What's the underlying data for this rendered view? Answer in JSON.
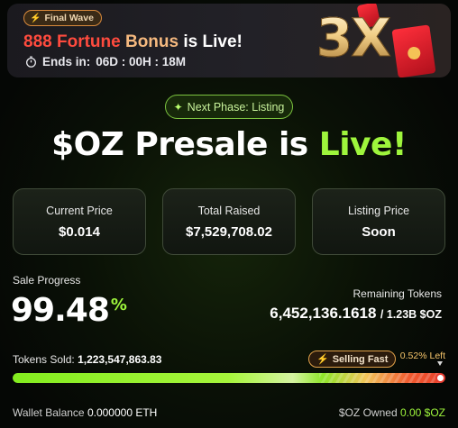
{
  "banner": {
    "badge_icon": "lightning-icon",
    "badge_label": "Final Wave",
    "title_part1": "888 Fortune",
    "title_part2": "Bonus",
    "title_part3": "is Live!",
    "countdown_icon": "stopwatch-icon",
    "countdown_label": "Ends in:",
    "countdown_value": "06D : 00H : 18M",
    "multiplier": "3X",
    "colors": {
      "red": "#ff4b3e",
      "gold": "#f5b97f"
    }
  },
  "phase_pill": {
    "icon": "sparkle-icon",
    "label": "Next Phase: Listing"
  },
  "headline": {
    "part1": "$OZ Presale is",
    "part2": "Live!"
  },
  "stats": [
    {
      "label": "Current Price",
      "value": "$0.014"
    },
    {
      "label": "Total Raised",
      "value": "$7,529,708.02"
    },
    {
      "label": "Listing Price",
      "value": "Soon"
    }
  ],
  "progress": {
    "sale_label": "Sale Progress",
    "percent": "99.48",
    "percent_sign": "%",
    "remaining_label": "Remaining Tokens",
    "remaining_value": "6,452,136.1618",
    "remaining_total": "/ 1.23B $OZ",
    "sold_label": "Tokens Sold:",
    "sold_value": "1,223,547,863.83",
    "selling_fast_icon": "lightning-icon",
    "selling_fast_label": "Selling Fast",
    "left_label": "0.52% Left",
    "fill_fraction": 0.9948
  },
  "footer": {
    "wallet_label": "Wallet Balance",
    "wallet_value": "0.000000 ETH",
    "owned_label": "$OZ Owned",
    "owned_value": "0.00 $OZ"
  },
  "accent_color": "#9ef53c"
}
